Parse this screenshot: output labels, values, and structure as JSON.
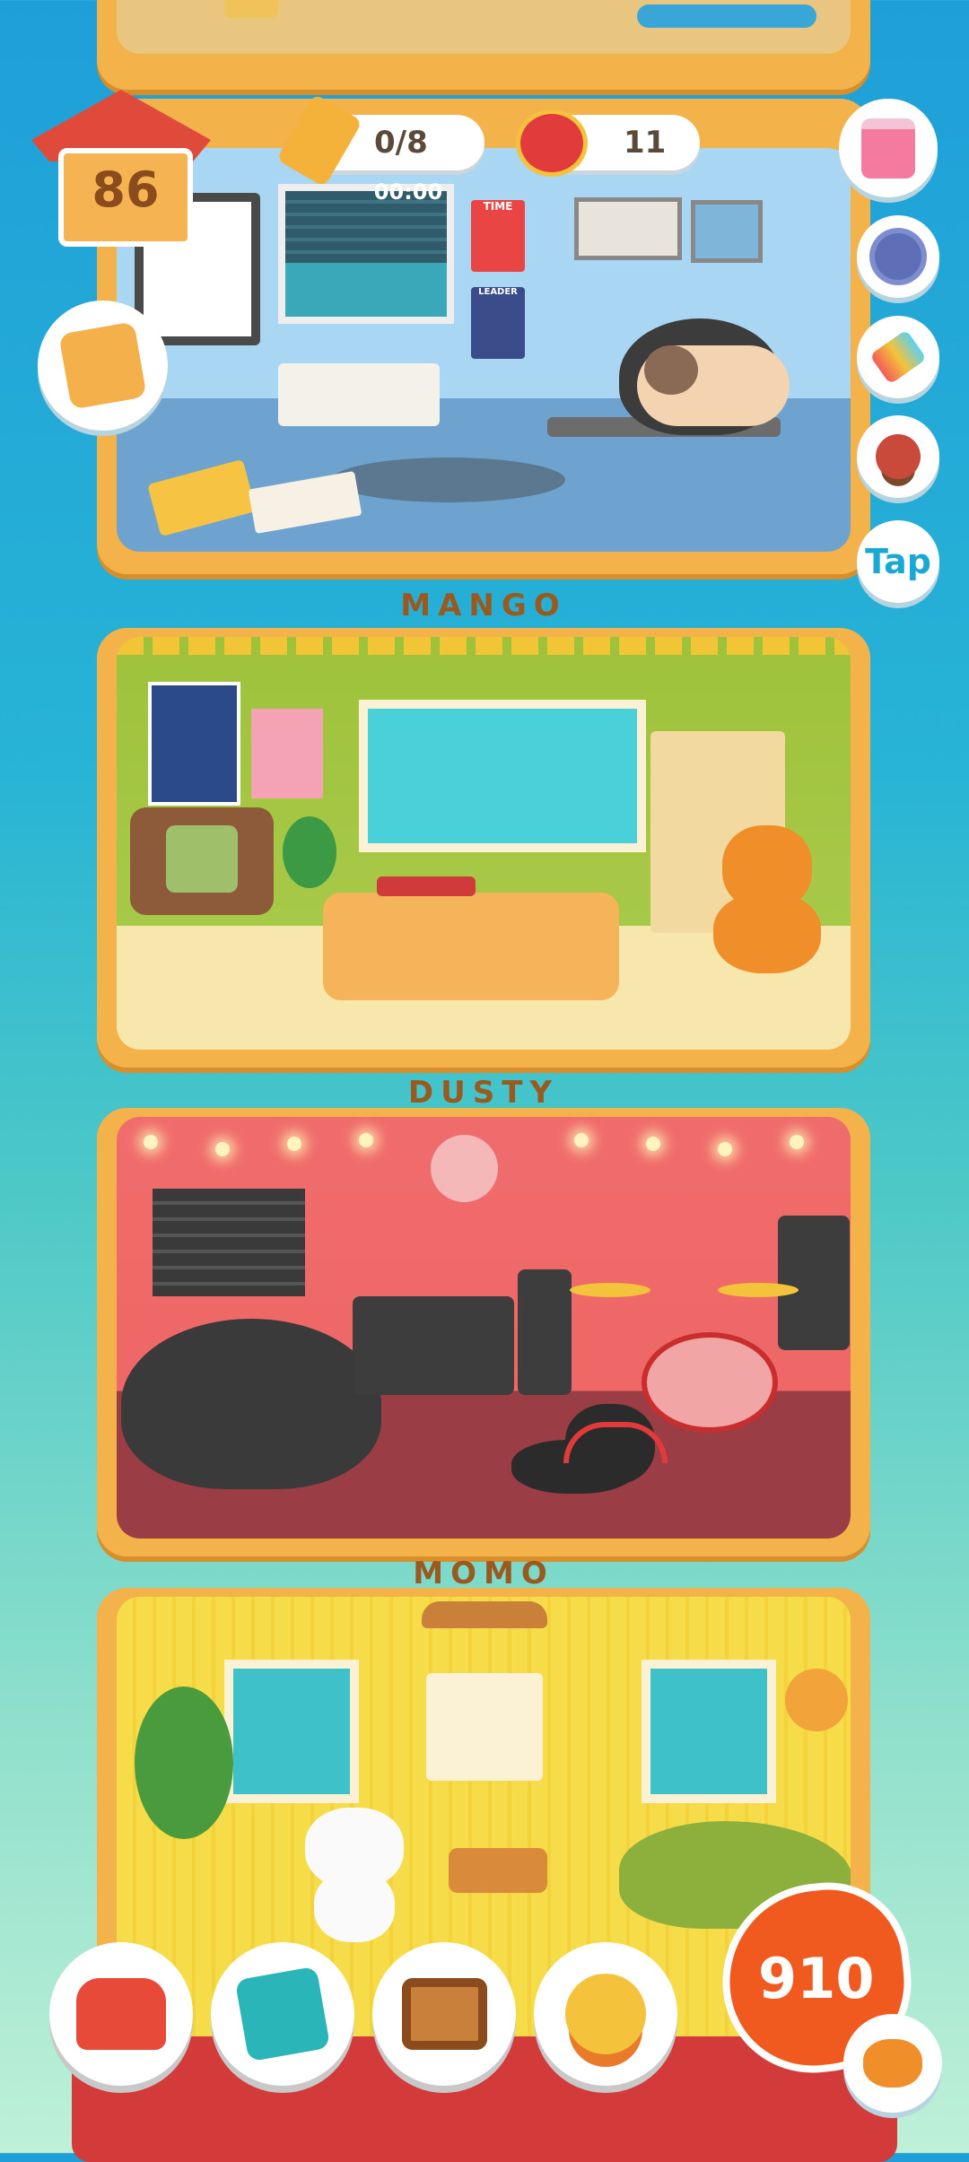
{
  "hud": {
    "house_level": "86",
    "pencil_progress": "0/8",
    "timer": "00:00",
    "fish_can_count": "11",
    "tap_label": "Tap",
    "currency": "910"
  },
  "rooms": [
    {
      "name": "",
      "poster_time": "TIME",
      "poster_leader": "LEADER"
    },
    {
      "name": "MANGO"
    },
    {
      "name": "DUSTY"
    },
    {
      "name": "MOMO"
    }
  ],
  "icons": {
    "house": "house-icon",
    "pencil": "pencil-icon",
    "fish_can": "fish-can-icon",
    "gift": "gift-icon",
    "settings": "gear-icon",
    "paint": "paint-roller-icon",
    "stamp": "stamp-icon",
    "furniture": "armchair-icon",
    "catalog": "paw-book-icon",
    "photo": "photo-frame-icon",
    "trophy": "trophy-globe-icon",
    "cat_face": "cat-face-icon"
  },
  "colors": {
    "frame": "#f3b24a",
    "accent_orange": "#f05a1e",
    "text_brown": "#9a5a1f"
  }
}
